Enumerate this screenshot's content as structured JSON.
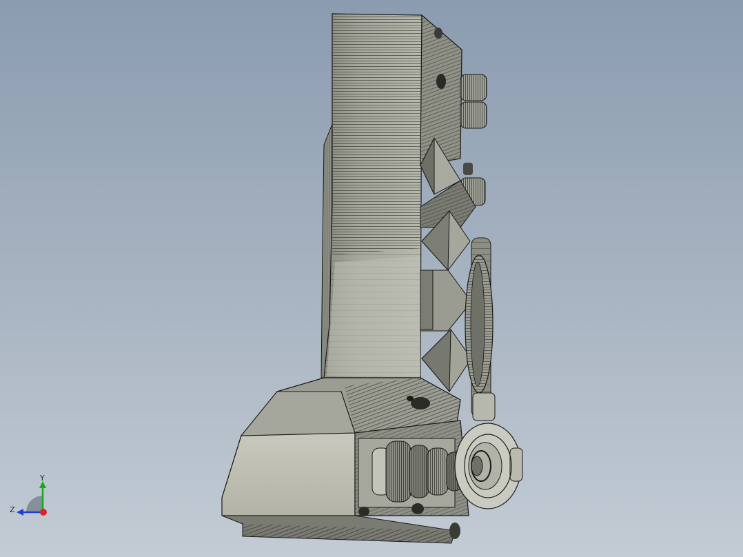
{
  "viewport": {
    "background_top": "#8b9cb0",
    "background_bottom": "#c3ccd5"
  },
  "model": {
    "shading_light": "#c6c7bd",
    "shading_mid": "#9e9f94",
    "shading_dark": "#6f7068",
    "edge_color": "#1a1a18"
  },
  "triad": {
    "y_label": "Y",
    "z_label": "Z",
    "y_color": "#19a819",
    "z_color": "#1f3fd1",
    "x_color": "#e0202a"
  }
}
